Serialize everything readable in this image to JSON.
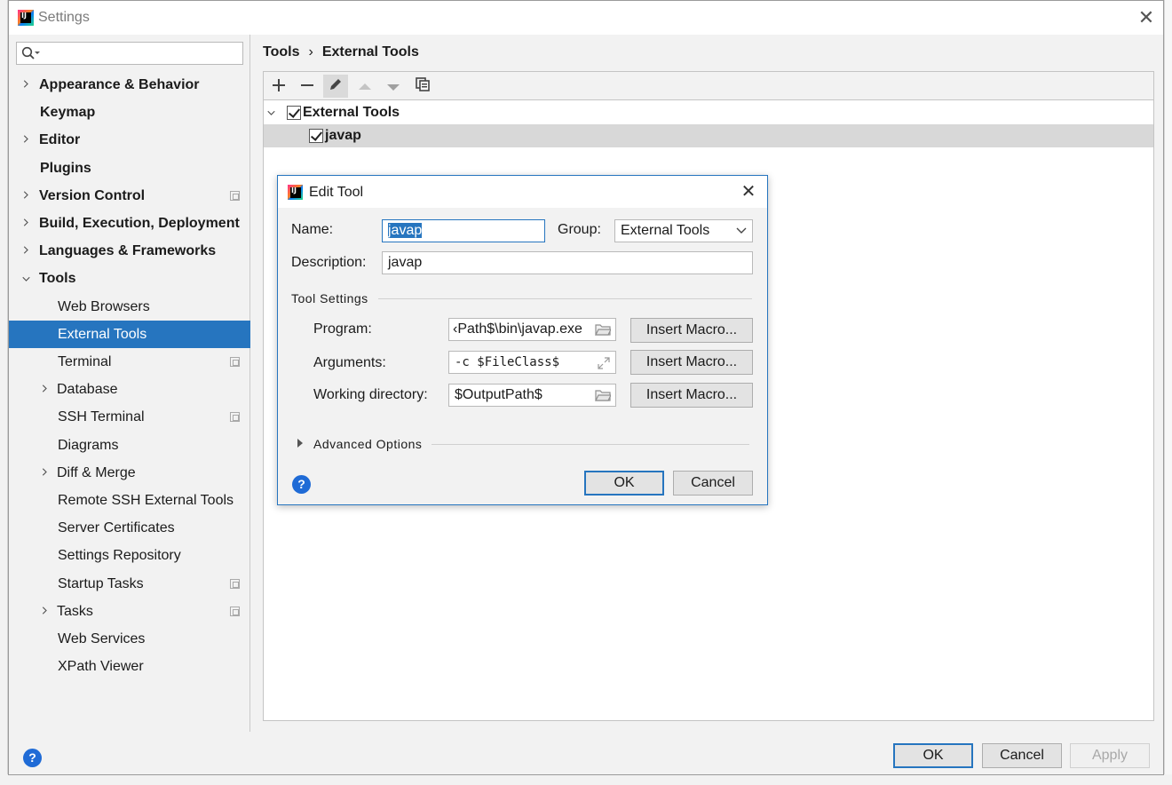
{
  "window": {
    "title": "Settings"
  },
  "search": {
    "placeholder": "",
    "value": ""
  },
  "sidebar": {
    "items": [
      {
        "label": "Appearance & Behavior",
        "bold": true,
        "expandable": true,
        "expanded": false
      },
      {
        "label": "Keymap",
        "bold": true
      },
      {
        "label": "Editor",
        "bold": true,
        "expandable": true,
        "expanded": false
      },
      {
        "label": "Plugins",
        "bold": true
      },
      {
        "label": "Version Control",
        "bold": true,
        "expandable": true,
        "expanded": false,
        "project_icon": true
      },
      {
        "label": "Build, Execution, Deployment",
        "bold": true,
        "expandable": true,
        "expanded": false
      },
      {
        "label": "Languages & Frameworks",
        "bold": true,
        "expandable": true,
        "expanded": false
      },
      {
        "label": "Tools",
        "bold": true,
        "expandable": true,
        "expanded": true
      },
      {
        "label": "Web Browsers"
      },
      {
        "label": "External Tools",
        "selected": true
      },
      {
        "label": "Terminal",
        "project_icon": true
      },
      {
        "label": "Database",
        "expandable": true,
        "expanded": false
      },
      {
        "label": "SSH Terminal",
        "project_icon": true
      },
      {
        "label": "Diagrams"
      },
      {
        "label": "Diff & Merge",
        "expandable": true,
        "expanded": false
      },
      {
        "label": "Remote SSH External Tools"
      },
      {
        "label": "Server Certificates"
      },
      {
        "label": "Settings Repository"
      },
      {
        "label": "Startup Tasks",
        "project_icon": true
      },
      {
        "label": "Tasks",
        "expandable": true,
        "expanded": false,
        "project_icon": true
      },
      {
        "label": "Web Services"
      },
      {
        "label": "XPath Viewer"
      }
    ]
  },
  "breadcrumb": {
    "parent": "Tools",
    "separator": "›",
    "current": "External Tools"
  },
  "toolbar": {
    "icons": [
      "plus-icon",
      "minus-icon",
      "pencil-icon",
      "arrow-up-icon",
      "arrow-down-icon",
      "copy-icon"
    ]
  },
  "tool_tree": {
    "group": {
      "label": "External Tools",
      "checked": true,
      "expanded": true
    },
    "tools": [
      {
        "label": "javap",
        "checked": true,
        "selected": true
      }
    ]
  },
  "footer": {
    "ok_label": "OK",
    "cancel_label": "Cancel",
    "apply_label": "Apply",
    "help_label": "?"
  },
  "dialog": {
    "title": "Edit Tool",
    "name_label": "Name:",
    "name_value": "javap",
    "group_label": "Group:",
    "group_value": "External Tools",
    "description_label": "Description:",
    "description_value": "javap",
    "tool_settings_label": "Tool Settings",
    "program_label": "Program:",
    "program_value": "‹Path$\\bin\\javap.exe",
    "arguments_label": "Arguments:",
    "arguments_value": "-c $FileClass$",
    "working_dir_label": "Working directory:",
    "working_dir_value": "$OutputPath$",
    "insert_macro_label": "Insert Macro...",
    "advanced_label": "Advanced Options",
    "ok_label": "OK",
    "cancel_label": "Cancel",
    "help_label": "?"
  },
  "colors": {
    "accent": "#2675bf",
    "selection_gray": "#d8d8d8",
    "help_blue": "#1f6bd6"
  }
}
